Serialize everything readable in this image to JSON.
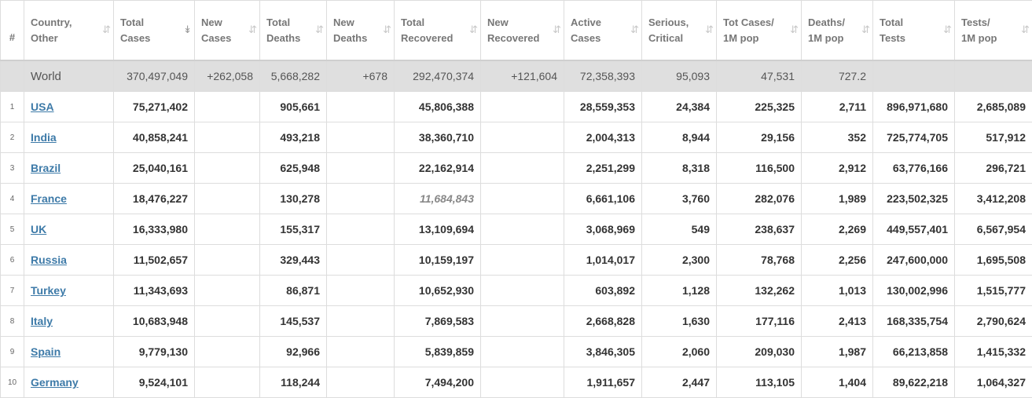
{
  "columns": [
    {
      "key": "rank",
      "line1": "#",
      "line2": ""
    },
    {
      "key": "country",
      "line1": "Country,",
      "line2": "Other"
    },
    {
      "key": "total_cases",
      "line1": "Total",
      "line2": "Cases"
    },
    {
      "key": "new_cases",
      "line1": "New",
      "line2": "Cases"
    },
    {
      "key": "total_deaths",
      "line1": "Total",
      "line2": "Deaths"
    },
    {
      "key": "new_deaths",
      "line1": "New",
      "line2": "Deaths"
    },
    {
      "key": "total_recovered",
      "line1": "Total",
      "line2": "Recovered"
    },
    {
      "key": "new_recovered",
      "line1": "New",
      "line2": "Recovered"
    },
    {
      "key": "active_cases",
      "line1": "Active",
      "line2": "Cases"
    },
    {
      "key": "serious_critical",
      "line1": "Serious,",
      "line2": "Critical"
    },
    {
      "key": "cases_per_1m",
      "line1": "Tot Cases/",
      "line2": "1M pop"
    },
    {
      "key": "deaths_per_1m",
      "line1": "Deaths/",
      "line2": "1M pop"
    },
    {
      "key": "total_tests",
      "line1": "Total",
      "line2": "Tests"
    },
    {
      "key": "tests_per_1m",
      "line1": "Tests/",
      "line2": "1M pop"
    }
  ],
  "sort_icon": "⇵",
  "active_sort_icon": "↡",
  "world": {
    "country": "World",
    "total_cases": "370,497,049",
    "new_cases": "+262,058",
    "total_deaths": "5,668,282",
    "new_deaths": "+678",
    "total_recovered": "292,470,374",
    "new_recovered": "+121,604",
    "active_cases": "72,358,393",
    "serious_critical": "95,093",
    "cases_per_1m": "47,531",
    "deaths_per_1m": "727.2",
    "total_tests": "",
    "tests_per_1m": ""
  },
  "rows": [
    {
      "rank": "1",
      "country": "USA",
      "total_cases": "75,271,402",
      "new_cases": "",
      "total_deaths": "905,661",
      "new_deaths": "",
      "total_recovered": "45,806,388",
      "new_recovered": "",
      "active_cases": "28,559,353",
      "serious_critical": "24,384",
      "cases_per_1m": "225,325",
      "deaths_per_1m": "2,711",
      "total_tests": "896,971,680",
      "tests_per_1m": "2,685,089"
    },
    {
      "rank": "2",
      "country": "India",
      "total_cases": "40,858,241",
      "new_cases": "",
      "total_deaths": "493,218",
      "new_deaths": "",
      "total_recovered": "38,360,710",
      "new_recovered": "",
      "active_cases": "2,004,313",
      "serious_critical": "8,944",
      "cases_per_1m": "29,156",
      "deaths_per_1m": "352",
      "total_tests": "725,774,705",
      "tests_per_1m": "517,912"
    },
    {
      "rank": "3",
      "country": "Brazil",
      "total_cases": "25,040,161",
      "new_cases": "",
      "total_deaths": "625,948",
      "new_deaths": "",
      "total_recovered": "22,162,914",
      "new_recovered": "",
      "active_cases": "2,251,299",
      "serious_critical": "8,318",
      "cases_per_1m": "116,500",
      "deaths_per_1m": "2,912",
      "total_tests": "63,776,166",
      "tests_per_1m": "296,721"
    },
    {
      "rank": "4",
      "country": "France",
      "total_cases": "18,476,227",
      "new_cases": "",
      "total_deaths": "130,278",
      "new_deaths": "",
      "total_recovered": "11,684,843",
      "recovered_italic": true,
      "new_recovered": "",
      "active_cases": "6,661,106",
      "serious_critical": "3,760",
      "cases_per_1m": "282,076",
      "deaths_per_1m": "1,989",
      "total_tests": "223,502,325",
      "tests_per_1m": "3,412,208"
    },
    {
      "rank": "5",
      "country": "UK",
      "total_cases": "16,333,980",
      "new_cases": "",
      "total_deaths": "155,317",
      "new_deaths": "",
      "total_recovered": "13,109,694",
      "new_recovered": "",
      "active_cases": "3,068,969",
      "serious_critical": "549",
      "cases_per_1m": "238,637",
      "deaths_per_1m": "2,269",
      "total_tests": "449,557,401",
      "tests_per_1m": "6,567,954"
    },
    {
      "rank": "6",
      "country": "Russia",
      "total_cases": "11,502,657",
      "new_cases": "",
      "total_deaths": "329,443",
      "new_deaths": "",
      "total_recovered": "10,159,197",
      "new_recovered": "",
      "active_cases": "1,014,017",
      "serious_critical": "2,300",
      "cases_per_1m": "78,768",
      "deaths_per_1m": "2,256",
      "total_tests": "247,600,000",
      "tests_per_1m": "1,695,508"
    },
    {
      "rank": "7",
      "country": "Turkey",
      "total_cases": "11,343,693",
      "new_cases": "",
      "total_deaths": "86,871",
      "new_deaths": "",
      "total_recovered": "10,652,930",
      "new_recovered": "",
      "active_cases": "603,892",
      "serious_critical": "1,128",
      "cases_per_1m": "132,262",
      "deaths_per_1m": "1,013",
      "total_tests": "130,002,996",
      "tests_per_1m": "1,515,777"
    },
    {
      "rank": "8",
      "country": "Italy",
      "total_cases": "10,683,948",
      "new_cases": "",
      "total_deaths": "145,537",
      "new_deaths": "",
      "total_recovered": "7,869,583",
      "new_recovered": "",
      "active_cases": "2,668,828",
      "serious_critical": "1,630",
      "cases_per_1m": "177,116",
      "deaths_per_1m": "2,413",
      "total_tests": "168,335,754",
      "tests_per_1m": "2,790,624"
    },
    {
      "rank": "9",
      "country": "Spain",
      "total_cases": "9,779,130",
      "new_cases": "",
      "total_deaths": "92,966",
      "new_deaths": "",
      "total_recovered": "5,839,859",
      "new_recovered": "",
      "active_cases": "3,846,305",
      "serious_critical": "2,060",
      "cases_per_1m": "209,030",
      "deaths_per_1m": "1,987",
      "total_tests": "66,213,858",
      "tests_per_1m": "1,415,332"
    },
    {
      "rank": "10",
      "country": "Germany",
      "total_cases": "9,524,101",
      "new_cases": "",
      "total_deaths": "118,244",
      "new_deaths": "",
      "total_recovered": "7,494,200",
      "new_recovered": "",
      "active_cases": "1,911,657",
      "serious_critical": "2,447",
      "cases_per_1m": "113,105",
      "deaths_per_1m": "1,404",
      "total_tests": "89,622,218",
      "tests_per_1m": "1,064,327"
    }
  ]
}
